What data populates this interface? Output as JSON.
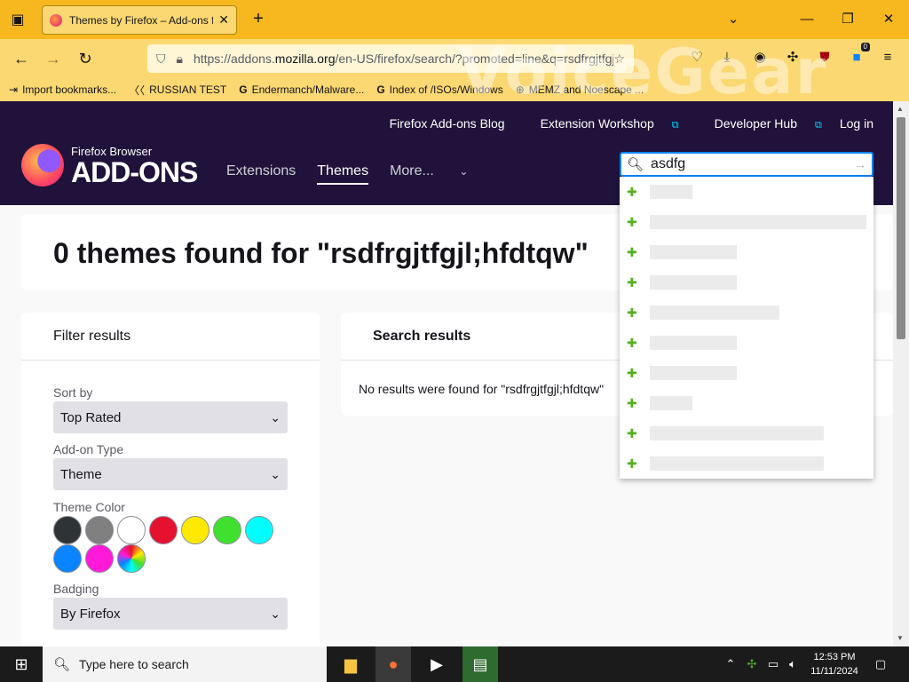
{
  "browser": {
    "tab_title": "Themes by Firefox – Add-ons for Firefox",
    "url_prefix": "https://addons.",
    "url_domain": "mozilla.org",
    "url_rest": "/en-US/firefox/search/?promoted=line&q=rsdfrgjtfgjl;hfdtqw",
    "extension_badge": "0",
    "watermark": "VoiceGear",
    "bookmarks": [
      {
        "icon": "import-icon",
        "label": "Import bookmarks..."
      },
      {
        "icon": "folder-icon",
        "label": "RUSSIAN TEST"
      },
      {
        "icon": "google-icon",
        "label": "Endermanch/Malware..."
      },
      {
        "icon": "google-icon",
        "label": "Index of /ISOs/Windows"
      },
      {
        "icon": "globe-icon",
        "label": "MEMZ and Noescape ..."
      }
    ]
  },
  "site": {
    "toplinks": {
      "blog": "Firefox Add-ons Blog",
      "workshop": "Extension Workshop",
      "devhub": "Developer Hub",
      "login": "Log in"
    },
    "logo_small": "Firefox Browser",
    "logo_big": "ADD-ONS",
    "nav": {
      "extensions": "Extensions",
      "themes": "Themes",
      "more": "More..."
    },
    "search_value": "asdfg",
    "suggestion_widths": [
      48,
      244,
      98,
      98,
      146,
      98,
      98,
      48,
      196,
      196
    ]
  },
  "results": {
    "title": "0 themes found for \"rsdfrgjtfgjl;hfdtqw\"",
    "search_results_heading": "Search results",
    "no_results_text": "No results were found for \"rsdfrgjtfgjl;hfdtqw\""
  },
  "filters": {
    "heading": "Filter results",
    "sort_label": "Sort by",
    "sort_value": "Top Rated",
    "type_label": "Add-on Type",
    "type_value": "Theme",
    "color_label": "Theme Color",
    "colors": [
      "#2e3436",
      "#808080",
      "#ffffff",
      "#e6112e",
      "#ffe900",
      "#3fe12e",
      "#00feff",
      "#0a84ff",
      "#ff1ad9"
    ],
    "badging_label": "Badging",
    "badging_value": "By Firefox"
  },
  "taskbar": {
    "search_placeholder": "Type here to search",
    "time": "12:53 PM",
    "date": "11/11/2024"
  }
}
